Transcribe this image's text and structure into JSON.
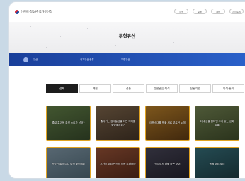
{
  "header": {
    "logo_text": "어린이·청소년 국가유산청",
    "top_buttons": [
      "검색",
      "교육",
      "체험",
      "사이트맵"
    ]
  },
  "hero": {
    "title": "무형유산"
  },
  "breadcrumb": [
    "유산",
    "국가유산 종류",
    "무형유산"
  ],
  "tabs": [
    {
      "label": "전체",
      "active": true
    },
    {
      "label": "예술",
      "active": false
    },
    {
      "label": "전통",
      "active": false
    },
    {
      "label": "생활관습·지식",
      "active": false
    },
    {
      "label": "전통기술",
      "active": false
    },
    {
      "label": "의식·놀이",
      "active": false
    }
  ],
  "cards": [
    {
      "title": "줄고 흥겨운 조선 소리가 났어?",
      "colors": [
        "#6b8b4e",
        "#3e5230"
      ]
    },
    {
      "title": "줄타기는 광대놀음을 어떤 의미를 줄었을까요?",
      "colors": [
        "#8a6f52",
        "#4b3a2b"
      ]
    },
    {
      "title": "태평성대를 평화 세로 부르던 노래",
      "colors": [
        "#c98b2e",
        "#6a4216"
      ]
    },
    {
      "title": "이 수공을 볼다면 조가 있는 공화 있을",
      "colors": [
        "#7e8f5a",
        "#46542e"
      ]
    },
    {
      "title": "한성인 놀러 다니 보던 좋인데요",
      "colors": [
        "#8ea7b8",
        "#55707e"
      ]
    },
    {
      "title": "온가오 우리 민간의 부릅 노래하라",
      "colors": [
        "#a65a3c",
        "#5a2c1c"
      ]
    },
    {
      "title": "엔지어서 해를 하는 것이",
      "colors": [
        "#4f4d60",
        "#25232f"
      ]
    },
    {
      "title": "음에 부른 노래",
      "colors": [
        "#3c7a86",
        "#1f4047"
      ]
    }
  ]
}
